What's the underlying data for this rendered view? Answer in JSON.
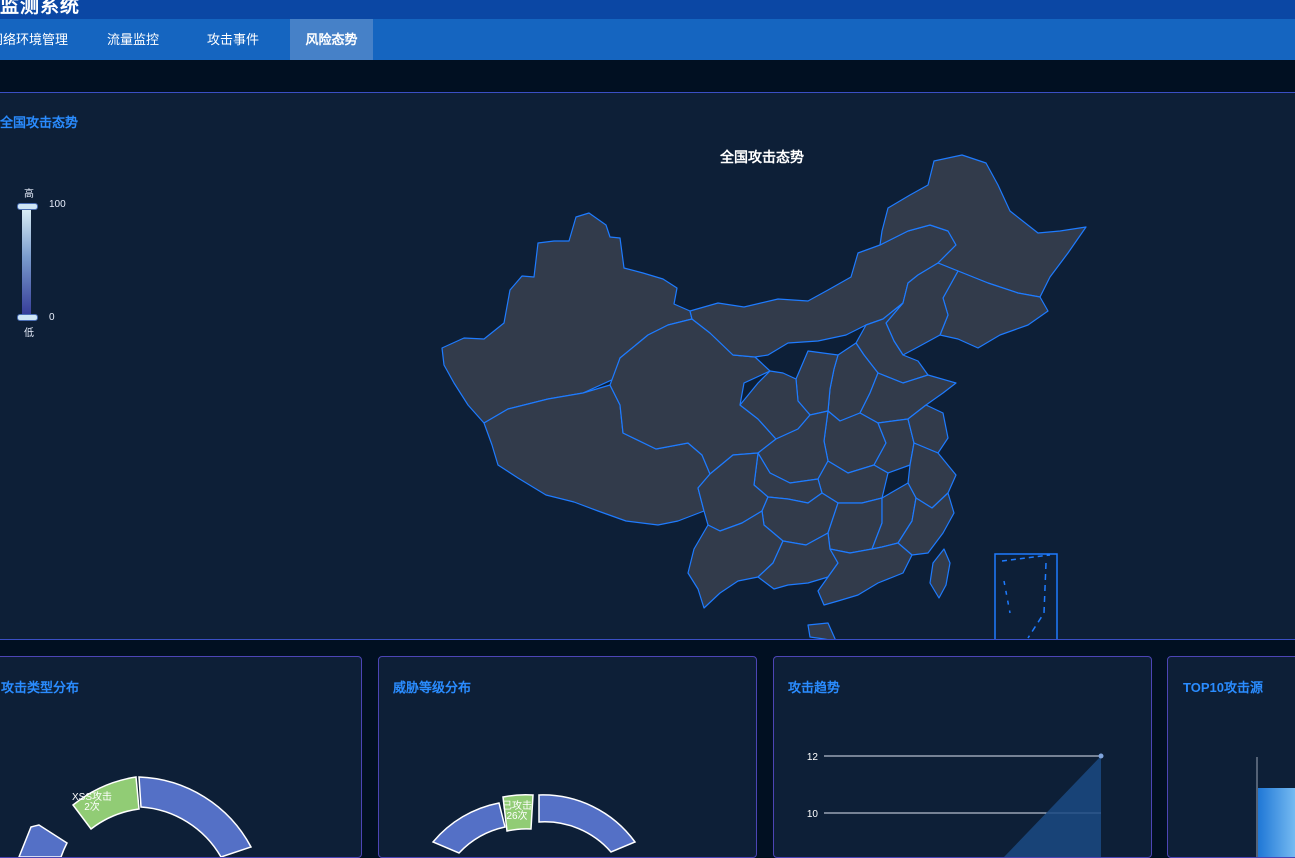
{
  "app": {
    "title": "监测系统"
  },
  "nav": {
    "tabs": [
      {
        "label": "网络环境管理",
        "active": false
      },
      {
        "label": "流量监控",
        "active": false
      },
      {
        "label": "攻击事件",
        "active": false
      },
      {
        "label": "风险态势",
        "active": true
      }
    ]
  },
  "map_panel": {
    "title": "全国攻击态势",
    "map_title": "全国攻击态势",
    "legend": {
      "high_label": "高",
      "low_label": "低",
      "max": "100",
      "min": "0"
    }
  },
  "cards": {
    "attack_type": {
      "title": "攻击类型分布",
      "segment_label": "XSS攻击",
      "segment_count": "2次"
    },
    "threat_level": {
      "title": "威胁等级分布",
      "segment_label": "已攻击",
      "segment_count": "26次"
    },
    "trend": {
      "title": "攻击趋势",
      "y_ticks": [
        "12",
        "10"
      ]
    },
    "top10": {
      "title": "TOP10攻击源"
    }
  },
  "colors": {
    "accent": "#2a8cff",
    "nav": "#1565c0",
    "nav_active": "#4681c8",
    "panel": "#0d1f37",
    "map_fill": "#323b4b",
    "map_border": "#1e7bff",
    "donut_blue": "#5470c6",
    "donut_green": "#91cc75"
  }
}
